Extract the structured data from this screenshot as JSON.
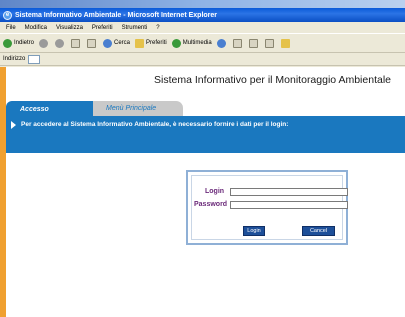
{
  "window": {
    "title": "Sistema Informativo Ambientale - Microsoft Internet Explorer"
  },
  "menubar": {
    "items": [
      "File",
      "Modifica",
      "Visualizza",
      "Preferiti",
      "Strumenti",
      "?"
    ]
  },
  "toolbar": {
    "back_label": "Indietro",
    "search_label": "Cerca",
    "favorites_label": "Preferiti",
    "multimedia_label": "Multimedia"
  },
  "addressbar": {
    "label": "Indirizzo"
  },
  "page": {
    "title": "Sistema Informativo per il Monitoraggio Ambientale",
    "tabs": [
      {
        "label": "Accesso",
        "active": true
      },
      {
        "label": "Menù Principale",
        "active": false
      }
    ],
    "message": "Per accedere al Sistema Informativo Ambientale,  è necessario fornire i dati per il login:"
  },
  "login_form": {
    "login_label": "Login",
    "password_label": "Password",
    "login_value": "",
    "password_value": "",
    "login_button": "Login",
    "cancel_button": "Cancel"
  },
  "colors": {
    "accent_blue": "#1a78bf",
    "label_purple": "#6b2a7a",
    "button_navy": "#1d4f99"
  }
}
